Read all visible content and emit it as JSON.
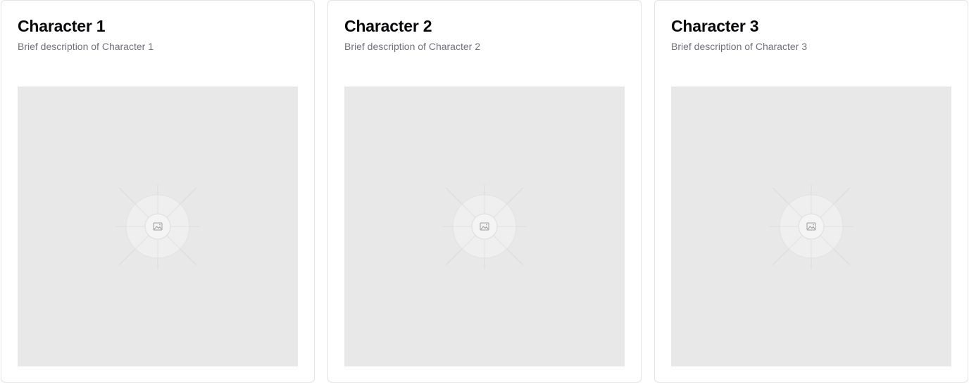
{
  "cards": [
    {
      "title": "Character 1",
      "description": "Brief description of Character 1",
      "image_icon": "image-icon"
    },
    {
      "title": "Character 2",
      "description": "Brief description of Character 2",
      "image_icon": "image-icon"
    },
    {
      "title": "Character 3",
      "description": "Brief description of Character 3",
      "image_icon": "image-icon"
    }
  ],
  "colors": {
    "background": "#ffffff",
    "card_border": "#e4e4e7",
    "title": "#09090b",
    "description": "#71717a",
    "placeholder": "#e8e8e8"
  }
}
